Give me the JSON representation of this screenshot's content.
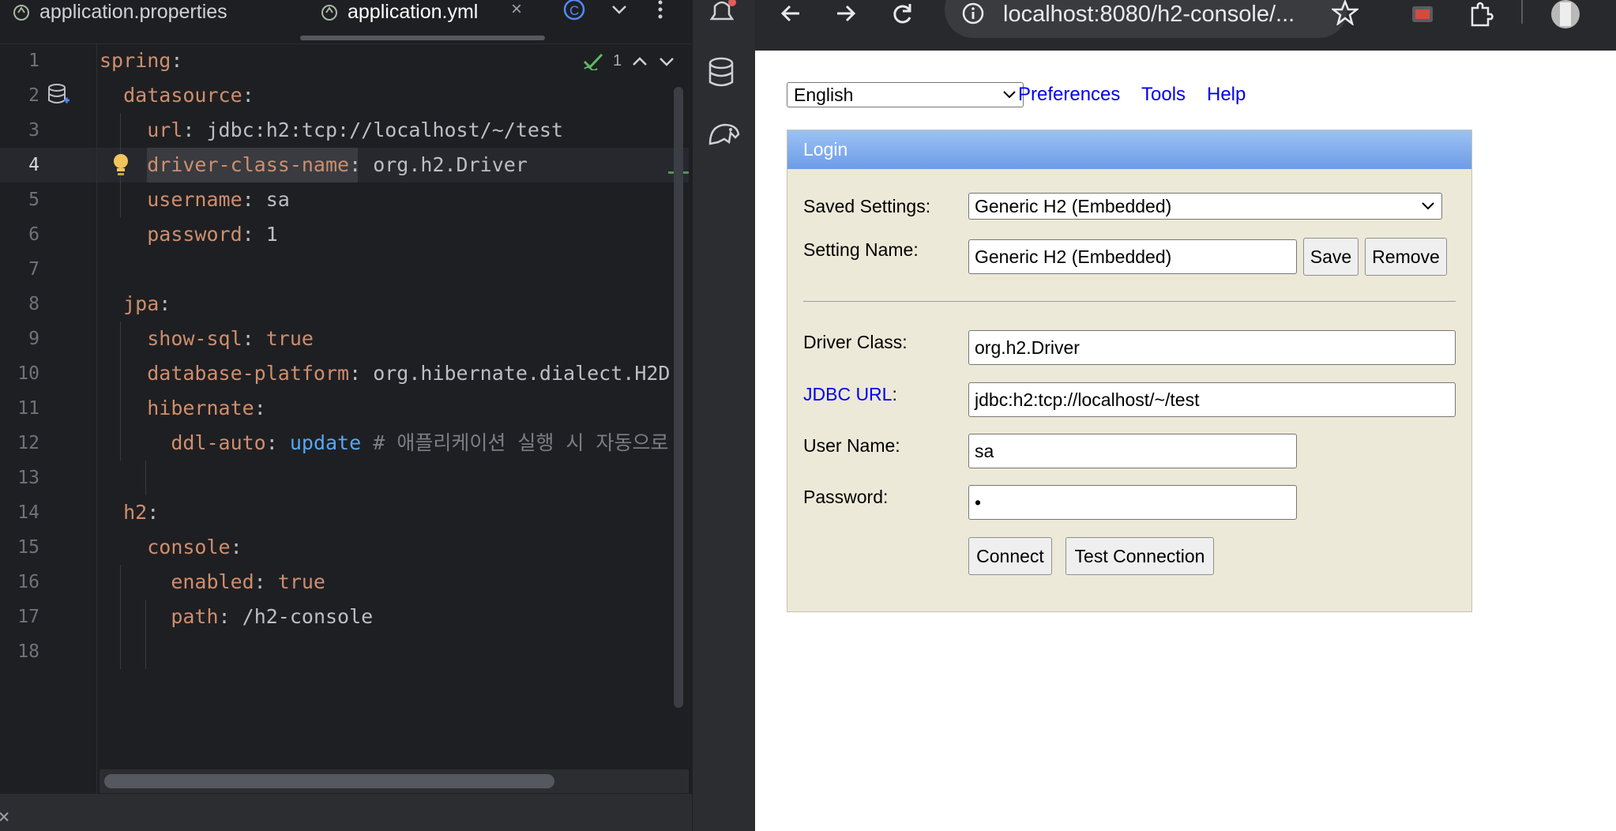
{
  "ide": {
    "tabs": [
      {
        "label": "application.properties"
      },
      {
        "label": "application.yml"
      }
    ],
    "close_symbol": "×",
    "inspection_count": "1",
    "line_numbers": [
      "1",
      "2",
      "3",
      "4",
      "5",
      "6",
      "7",
      "8",
      "9",
      "10",
      "11",
      "12",
      "13",
      "14",
      "15",
      "16",
      "17",
      "18"
    ],
    "code": {
      "l1_key": "spring",
      "l2_key": "datasource",
      "l3_key": "url",
      "l3_val": "jdbc:h2:tcp://localhost/~/test",
      "l4_key": "driver-class-name",
      "l4_val": "org.h2.Driver",
      "l5_key": "username",
      "l5_val": "sa",
      "l6_key": "password",
      "l6_val": "1",
      "l8_key": "jpa",
      "l9_key": "show-sql",
      "l9_val": "true",
      "l10_key": "database-platform",
      "l10_val": "org.hibernate.dialect.H2D",
      "l11_key": "hibernate",
      "l12_key": "ddl-auto",
      "l12_val": "update",
      "l12_comment": "# 애플리케이션 실행 시 자동으로 ",
      "l14_key": "h2",
      "l15_key": "console",
      "l16_key": "enabled",
      "l16_val": "true",
      "l17_key": "path",
      "l17_val": "/h2-console"
    }
  },
  "browser": {
    "url": "localhost:8080/h2-console/...",
    "language": "English",
    "links": {
      "preferences": "Preferences",
      "tools": "Tools",
      "help": "Help"
    },
    "login": {
      "title": "Login",
      "saved_settings_label": "Saved Settings:",
      "saved_settings_value": "Generic H2 (Embedded)",
      "setting_name_label": "Setting Name:",
      "setting_name_value": "Generic H2 (Embedded)",
      "save_label": "Save",
      "remove_label": "Remove",
      "driver_class_label": "Driver Class:",
      "driver_class_value": "org.h2.Driver",
      "jdbc_url_label": "JDBC URL",
      "jdbc_url_colon": ":",
      "jdbc_url_value": "jdbc:h2:tcp://localhost/~/test",
      "user_name_label": "User Name:",
      "user_name_value": "sa",
      "password_label": "Password:",
      "password_value": "•",
      "connect_label": "Connect",
      "test_connection_label": "Test Connection"
    }
  },
  "colors": {
    "ide_bg": "#1e1f22",
    "yaml_key": "#cf8e6d",
    "login_panel": "#ece9d8",
    "login_header": "#6d9ce6",
    "link": "#0000ee"
  },
  "icons": [
    "spring-leaf-icon",
    "close-icon",
    "class-icon",
    "chevron-down-icon",
    "more-vertical-icon",
    "bell-icon",
    "database-icon",
    "elephant-icon",
    "check-icon",
    "bulb-icon",
    "back-icon",
    "forward-icon",
    "reload-icon",
    "info-icon",
    "star-icon",
    "extensions-icon",
    "avatar"
  ]
}
